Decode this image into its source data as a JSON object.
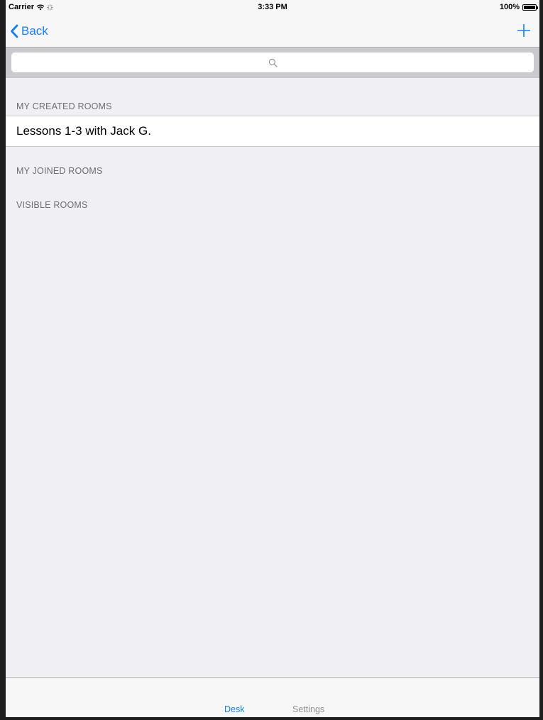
{
  "status_bar": {
    "carrier": "Carrier",
    "time": "3:33 PM",
    "battery_percent": "100%",
    "battery_level": 1.0
  },
  "nav_bar": {
    "back_label": "Back",
    "add_icon": "plus-icon",
    "accent_color": "#147efb"
  },
  "search": {
    "placeholder": "",
    "icon": "search-icon"
  },
  "sections": [
    {
      "header": "MY CREATED ROOMS",
      "rows": [
        "Lessons 1-3 with Jack G."
      ]
    },
    {
      "header": "MY JOINED ROOMS",
      "rows": []
    },
    {
      "header": "VISIBLE ROOMS",
      "rows": []
    }
  ],
  "tab_bar": {
    "tabs": [
      {
        "label": "Desk",
        "selected": true
      },
      {
        "label": "Settings",
        "selected": false
      }
    ]
  }
}
